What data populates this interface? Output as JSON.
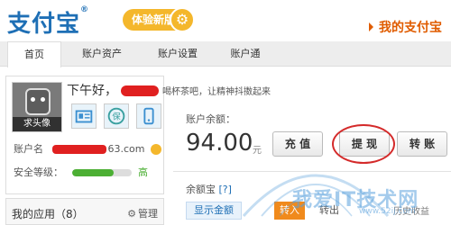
{
  "header": {
    "logo_text": "支付宝",
    "logo_reg": "®",
    "trial_badge": "体验新版",
    "my_alipay": "我的支付宝"
  },
  "nav": {
    "items": [
      {
        "label": "首页",
        "active": true
      },
      {
        "label": "账户资产",
        "active": false
      },
      {
        "label": "账户设置",
        "active": false
      },
      {
        "label": "账户通",
        "active": false
      }
    ]
  },
  "profile": {
    "avatar_label": "求头像",
    "greeting_prefix": "下午好，",
    "greeting_suffix": "喝杯茶吧，让精神抖擞起来",
    "account_label": "账户名",
    "account_suffix": "63.com",
    "security_label": "安全等级：",
    "security_level": "高",
    "security_progress": 0.7,
    "badge_icons": [
      "id-card-icon",
      "shield-icon",
      "phone-icon"
    ]
  },
  "apps": {
    "title": "我的应用（8）",
    "manage": "管理"
  },
  "balance": {
    "label": "账户余额：",
    "value": "94.00",
    "unit": "元",
    "buttons": {
      "recharge": "充 值",
      "withdraw": "提 现",
      "transfer": "转 账"
    }
  },
  "yuebao": {
    "label": "余额宝",
    "help": "[?]",
    "show_amount": "显示金额",
    "transfer_in": "转入",
    "transfer_out": "转出",
    "history": "历史收益"
  },
  "watermark": {
    "text": "我爱IT技术网",
    "url": "www.52ij.com"
  },
  "colors": {
    "brand_blue": "#1e6fb5",
    "accent_orange": "#e05c00",
    "badge_yellow": "#f4b72c",
    "security_green": "#4caf34",
    "highlight_red": "#d42a2a",
    "transfer_in_orange": "#f08a1c"
  }
}
